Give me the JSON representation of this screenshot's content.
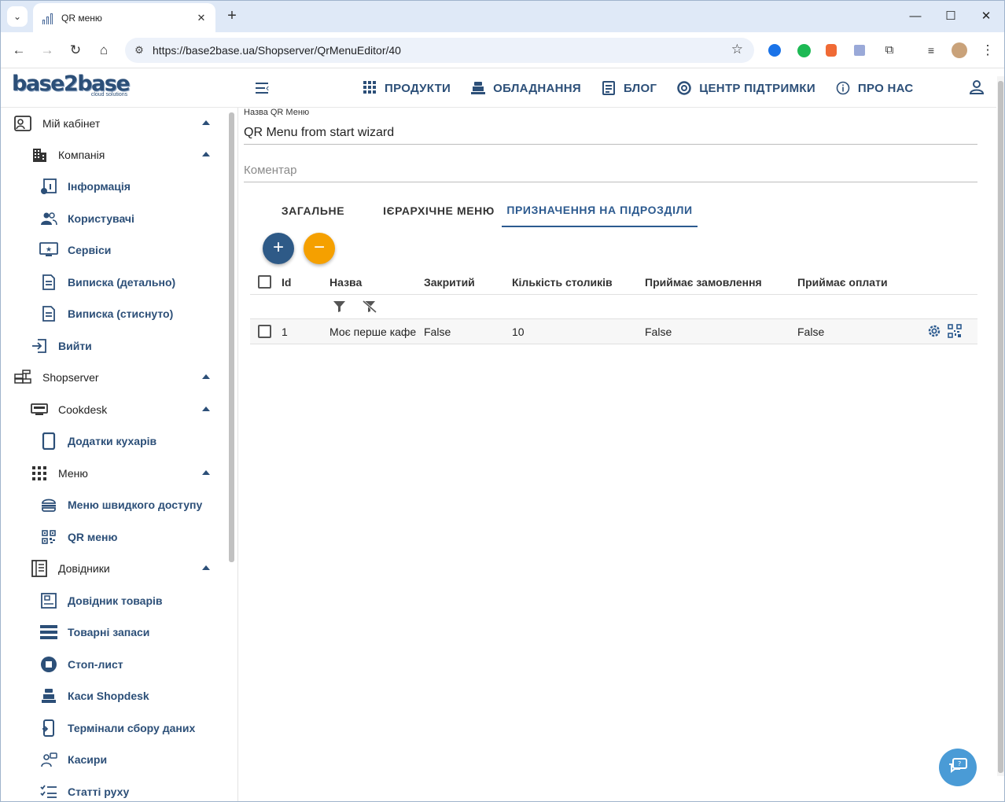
{
  "browser": {
    "tab_title": "QR меню",
    "url": "https://base2base.ua/Shopserver/QrMenuEditor/40"
  },
  "header": {
    "logo_text": "base2base",
    "logo_tagline": "cloud solutions",
    "nav": [
      {
        "label": "ПРОДУКТИ",
        "icon": "grid-icon"
      },
      {
        "label": "ОБЛАДНАННЯ",
        "icon": "cash-register-icon"
      },
      {
        "label": "БЛОГ",
        "icon": "document-icon"
      },
      {
        "label": "ЦЕНТР ПІДТРИМКИ",
        "icon": "lifebuoy-icon"
      },
      {
        "label": "ПРО НАС",
        "icon": "info-icon"
      }
    ]
  },
  "sidebar": {
    "items": [
      {
        "label": "Мій кабінет",
        "icon": "account-box-icon",
        "expanded": true
      },
      {
        "label": "Компанія",
        "icon": "building-icon",
        "expanded": true
      },
      {
        "label": "Інформація",
        "icon": "info-board-icon"
      },
      {
        "label": "Користувачі",
        "icon": "users-icon"
      },
      {
        "label": "Сервіси",
        "icon": "monitor-star-icon"
      },
      {
        "label": "Виписка (детально)",
        "icon": "statement-icon"
      },
      {
        "label": "Виписка (стиснуто)",
        "icon": "statement-compact-icon"
      },
      {
        "label": "Вийти",
        "icon": "logout-icon"
      },
      {
        "label": "Shopserver",
        "icon": "server-icon",
        "expanded": true
      },
      {
        "label": "Cookdesk",
        "icon": "cookdesk-icon",
        "expanded": true
      },
      {
        "label": "Додатки кухарів",
        "icon": "tablet-icon"
      },
      {
        "label": "Меню",
        "icon": "grid-menu-icon",
        "expanded": true
      },
      {
        "label": "Меню швидкого доступу",
        "icon": "burger-icon"
      },
      {
        "label": "QR меню",
        "icon": "qr-icon"
      },
      {
        "label": "Довідники",
        "icon": "catalog-icon",
        "expanded": true
      },
      {
        "label": "Довідник товарів",
        "icon": "product-catalog-icon"
      },
      {
        "label": "Товарні запаси",
        "icon": "stock-icon"
      },
      {
        "label": "Стоп-лист",
        "icon": "stop-icon"
      },
      {
        "label": "Каси Shopdesk",
        "icon": "cash-register-icon"
      },
      {
        "label": "Термінали сбору даних",
        "icon": "terminal-icon"
      },
      {
        "label": "Касири",
        "icon": "cashier-icon"
      },
      {
        "label": "Статті руху",
        "icon": "checklist-icon"
      }
    ]
  },
  "form": {
    "name_label": "Назва QR Меню",
    "name_value": "QR Menu from start wizard",
    "comment_placeholder": "Коментар",
    "tabs": [
      "ЗАГАЛЬНЕ",
      "ІЄРАРХІЧНЕ МЕНЮ",
      "ПРИЗНАЧЕННЯ НА ПІДРОЗДІЛИ"
    ],
    "active_tab": 2
  },
  "grid": {
    "columns": [
      "Id",
      "Назва",
      "Закритий",
      "Кількість столиків",
      "Приймає замовлення",
      "Приймає оплати"
    ],
    "rows": [
      {
        "id": "1",
        "name": "Моє перше кафе",
        "closed": "False",
        "tables": "10",
        "accepts_orders": "False",
        "accepts_payments": "False"
      }
    ]
  },
  "colors": {
    "primary": "#2c4f78",
    "fab_add": "#2e5a87",
    "fab_remove": "#f5a000",
    "chat": "#4a9bd6"
  }
}
